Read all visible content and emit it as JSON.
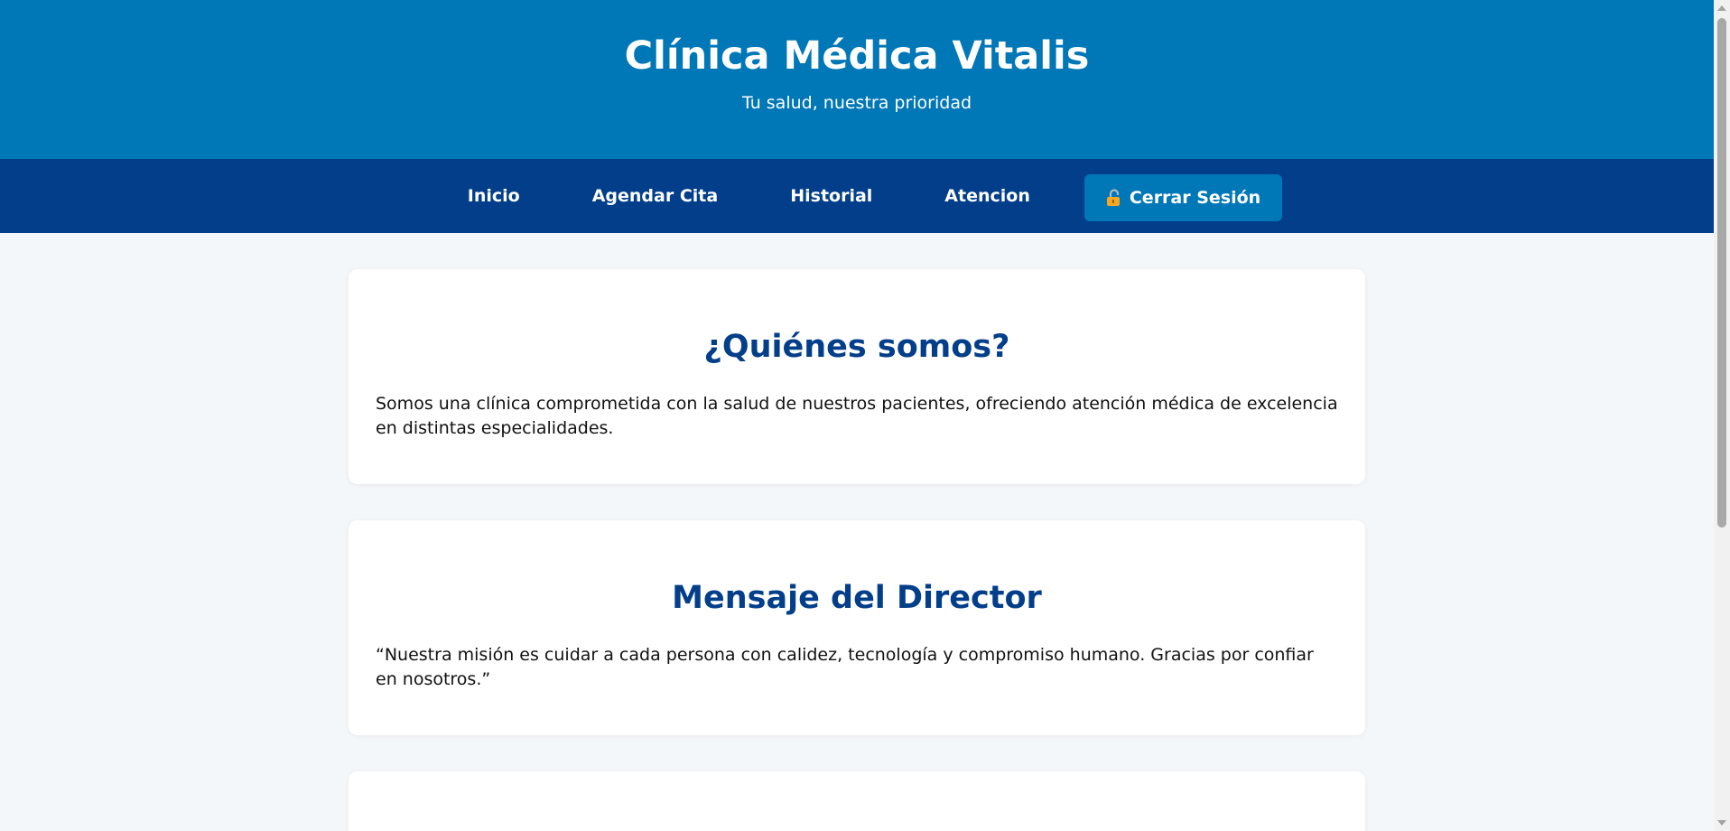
{
  "header": {
    "title": "Clínica Médica Vitalis",
    "tagline": "Tu salud, nuestra prioridad"
  },
  "nav": {
    "items": [
      {
        "label": "Inicio"
      },
      {
        "label": "Agendar Cita"
      },
      {
        "label": "Historial"
      },
      {
        "label": "Atencion"
      }
    ],
    "logout_label": "Cerrar Sesión",
    "logout_icon": "unlocked-padlock-icon"
  },
  "sections": [
    {
      "heading": "¿Quiénes somos?",
      "body": "Somos una clínica comprometida con la salud de nuestros pacientes, ofreciendo atención médica de excelencia en distintas especialidades."
    },
    {
      "heading": "Mensaje del Director",
      "body": "“Nuestra misión es cuidar a cada persona con calidez, tecnología y compromiso humano. Gracias por confiar en nosotros.”"
    }
  ],
  "colors": {
    "header_bg": "#0077b6",
    "nav_bg": "#023e8a",
    "heading_color": "#023e8a",
    "page_bg": "#f4f7fa"
  }
}
